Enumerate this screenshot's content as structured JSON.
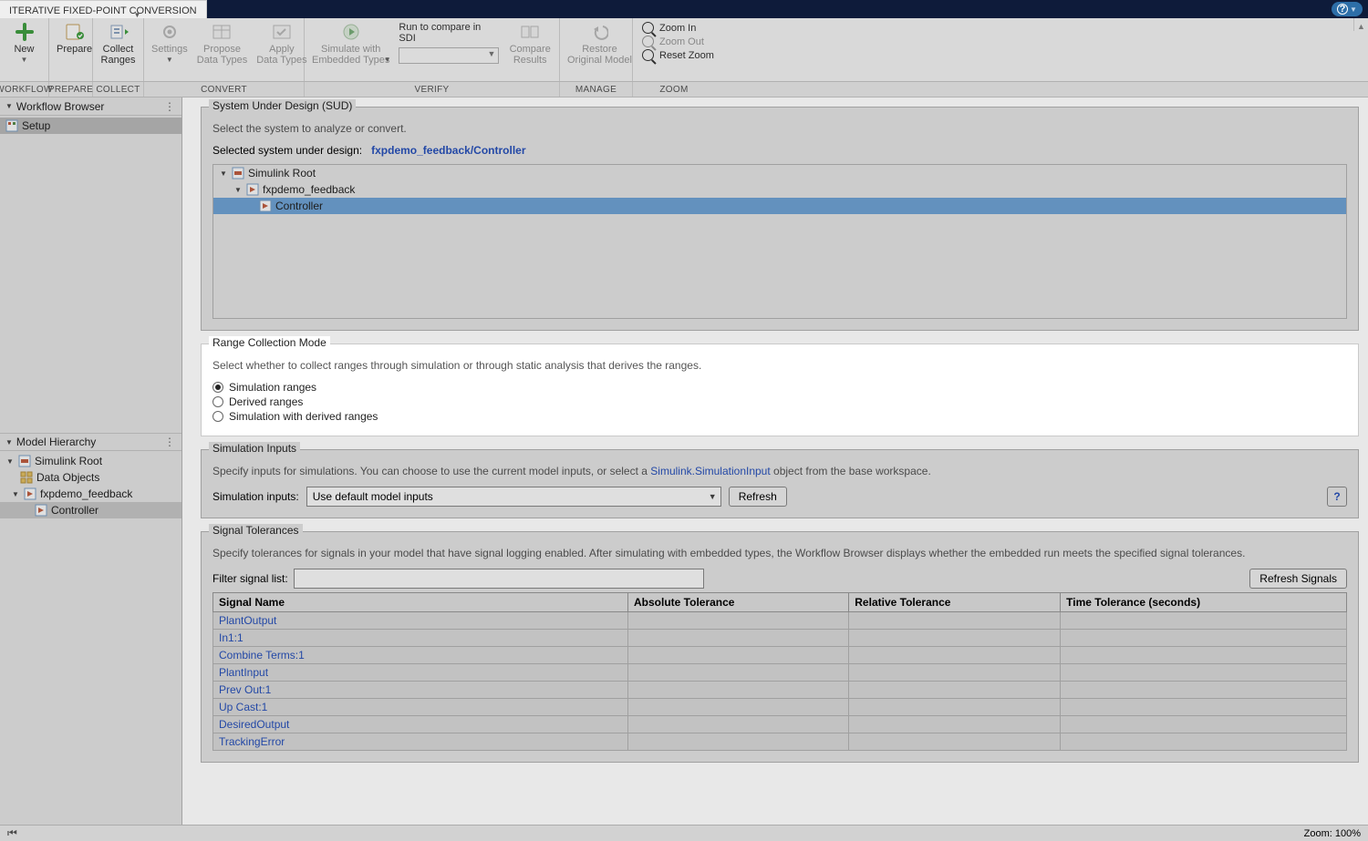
{
  "app": {
    "tab_title": "ITERATIVE FIXED-POINT CONVERSION"
  },
  "ribbon": {
    "new": "New",
    "prepare": "Prepare",
    "collect": "Collect\nRanges",
    "settings": "Settings",
    "propose": "Propose\nData Types",
    "apply": "Apply\nData Types",
    "simulate": "Simulate with\nEmbedded Types",
    "run_sdi": "Run to compare in SDI",
    "compare": "Compare\nResults",
    "restore": "Restore\nOriginal Model",
    "zoom_in": "Zoom In",
    "zoom_out": "Zoom Out",
    "reset_zoom": "Reset Zoom",
    "sections": {
      "workflow": "WORKFLOW",
      "prepare": "PREPARE",
      "collect": "COLLECT",
      "convert": "CONVERT",
      "verify": "VERIFY",
      "manage": "MANAGE",
      "zoom": "ZOOM"
    }
  },
  "left": {
    "workflow_title": "Workflow Browser",
    "setup": "Setup",
    "hierarchy_title": "Model Hierarchy",
    "root": "Simulink Root",
    "data_objects": "Data Objects",
    "model": "fxpdemo_feedback",
    "controller": "Controller"
  },
  "sud": {
    "title": "System Under Design (SUD)",
    "desc": "Select the system to analyze or convert.",
    "selected_label": "Selected system under design:",
    "selected_path": "fxpdemo_feedback/Controller",
    "tree": {
      "root": "Simulink Root",
      "model": "fxpdemo_feedback",
      "controller": "Controller"
    }
  },
  "range_mode": {
    "title": "Range Collection Mode",
    "desc": "Select whether to collect ranges through simulation or through static analysis that derives the ranges.",
    "o1": "Simulation ranges",
    "o2": "Derived ranges",
    "o3": "Simulation with derived ranges"
  },
  "sim_inputs": {
    "title": "Simulation Inputs",
    "desc_pre": "Specify inputs for simulations. You can choose to use the current model inputs, or select a ",
    "link": "Simulink.SimulationInput",
    "desc_post": " object from the base workspace.",
    "label": "Simulation inputs:",
    "value": "Use default model inputs",
    "refresh": "Refresh"
  },
  "signals": {
    "title": "Signal Tolerances",
    "desc": "Specify tolerances for signals in your model that have signal logging enabled. After simulating with embedded types, the Workflow Browser displays whether the embedded run meets the specified signal tolerances.",
    "filter_label": "Filter signal list:",
    "refresh": "Refresh Signals",
    "cols": {
      "name": "Signal Name",
      "abs": "Absolute Tolerance",
      "rel": "Relative Tolerance",
      "time": "Time Tolerance (seconds)"
    },
    "rows": [
      "PlantOutput",
      "In1:1",
      "Combine Terms:1",
      "PlantInput",
      "Prev Out:1",
      "Up Cast:1",
      "DesiredOutput",
      "TrackingError"
    ]
  },
  "status": {
    "zoom": "Zoom: 100%"
  }
}
